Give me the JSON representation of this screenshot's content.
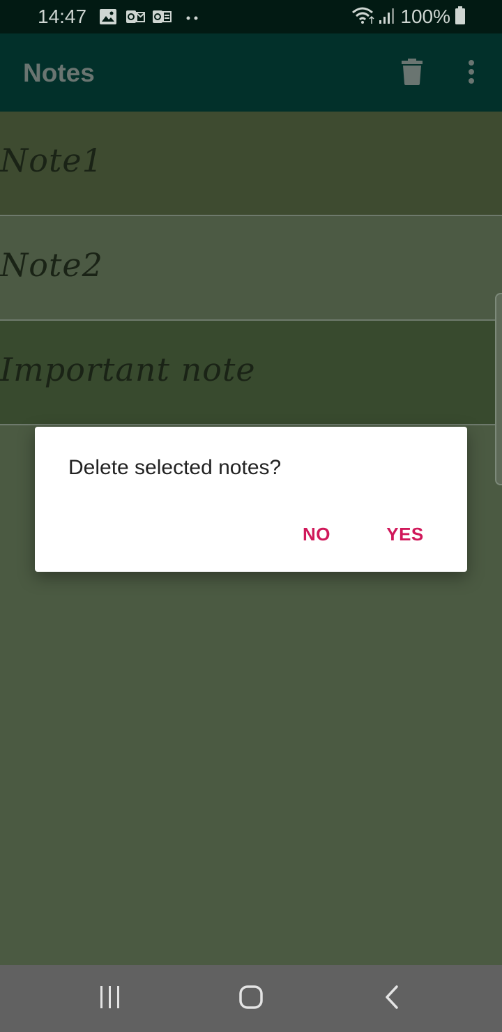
{
  "status_bar": {
    "time": "14:47",
    "battery": "100%",
    "icons": [
      "gallery-icon",
      "outlook-icon",
      "office-icon",
      "more-dots-icon",
      "wifi-icon",
      "signal-icon",
      "battery-icon"
    ]
  },
  "app_bar": {
    "title": "Notes",
    "actions": [
      "trash-icon",
      "more-vert-icon"
    ]
  },
  "notes": [
    {
      "title": "Note1",
      "color": "#3e4b30"
    },
    {
      "title": "Note2",
      "color": "#4c5a44"
    },
    {
      "title": "Important note",
      "color": "#384a2e"
    }
  ],
  "dialog": {
    "message": "Delete selected notes?",
    "negative_label": "NO",
    "positive_label": "YES",
    "accent_color": "#d0185a"
  },
  "nav_bar": {
    "buttons": [
      "recents-icon",
      "home-icon",
      "back-icon"
    ]
  }
}
